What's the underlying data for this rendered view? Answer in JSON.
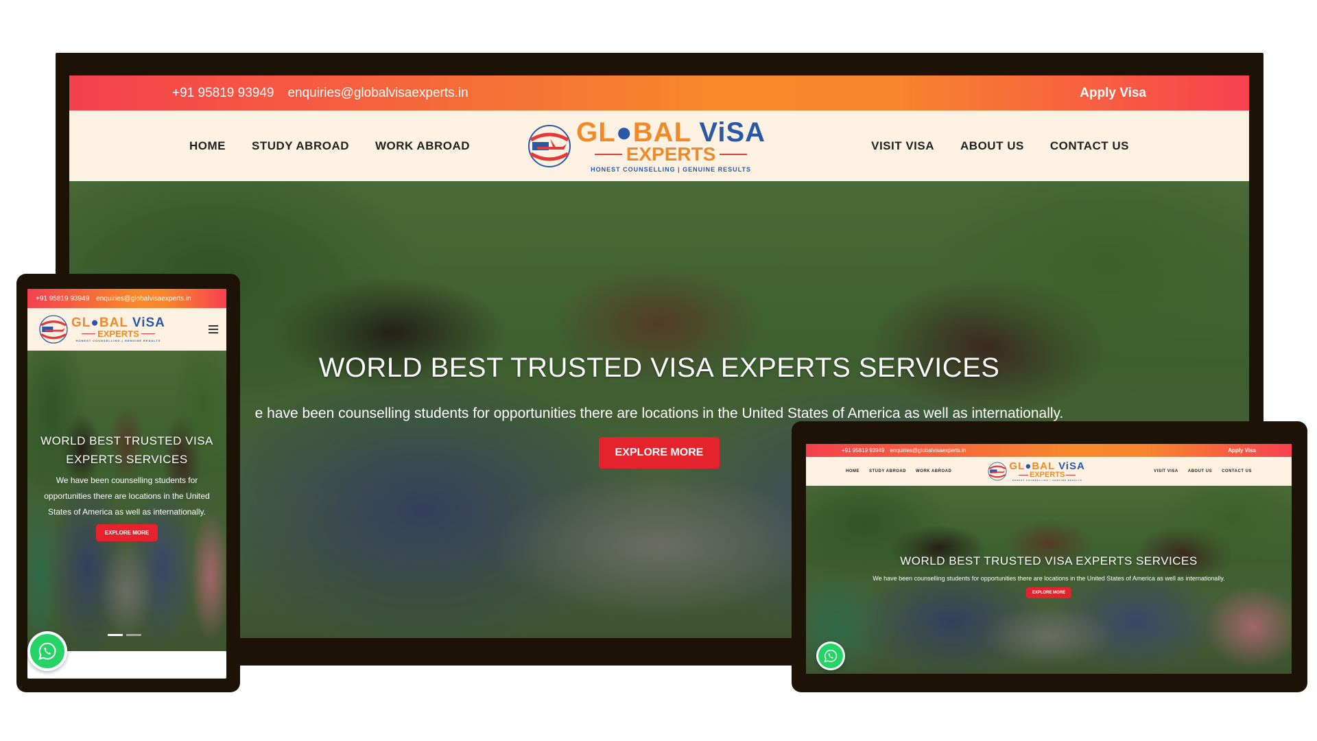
{
  "site": {
    "phone": "+91 95819 93949",
    "email": "enquiries@globalvisaexperts.in",
    "apply_label": "Apply Visa",
    "nav_left": [
      "HOME",
      "STUDY ABROAD",
      "WORK ABROAD"
    ],
    "nav_right": [
      "VISIT VISA",
      "ABOUT US",
      "CONTACT US"
    ],
    "logo": {
      "word1_a": "GL",
      "word1_b": "BAL",
      "word1_visa": "ViSA",
      "word2": "EXPERTS",
      "tagline": "HONEST COUNSELLING | GENUINE RESULTS"
    },
    "hero": {
      "title": "WORLD BEST TRUSTED VISA EXPERTS SERVICES",
      "subtitle": "We have been counselling students for opportunities there are locations in the United States of America as well as internationally.",
      "desktop_subtitle_visible": "e have been counselling students for opportunities there are locations in the United States of America as well as internationally.",
      "cta": "EXPLORE MORE"
    }
  },
  "colors": {
    "topbar_start": "#f5404e",
    "topbar_mid": "#f7892b",
    "nav_bg": "#fdf1e2",
    "cta_red": "#e5232d",
    "logo_orange": "#f08a28",
    "logo_blue": "#2a58a6",
    "device_frame": "#1c1206",
    "whatsapp_green": "#25d366"
  },
  "icons": [
    "globe-airplane-logo-icon",
    "hamburger-menu-icon",
    "whatsapp-icon"
  ]
}
